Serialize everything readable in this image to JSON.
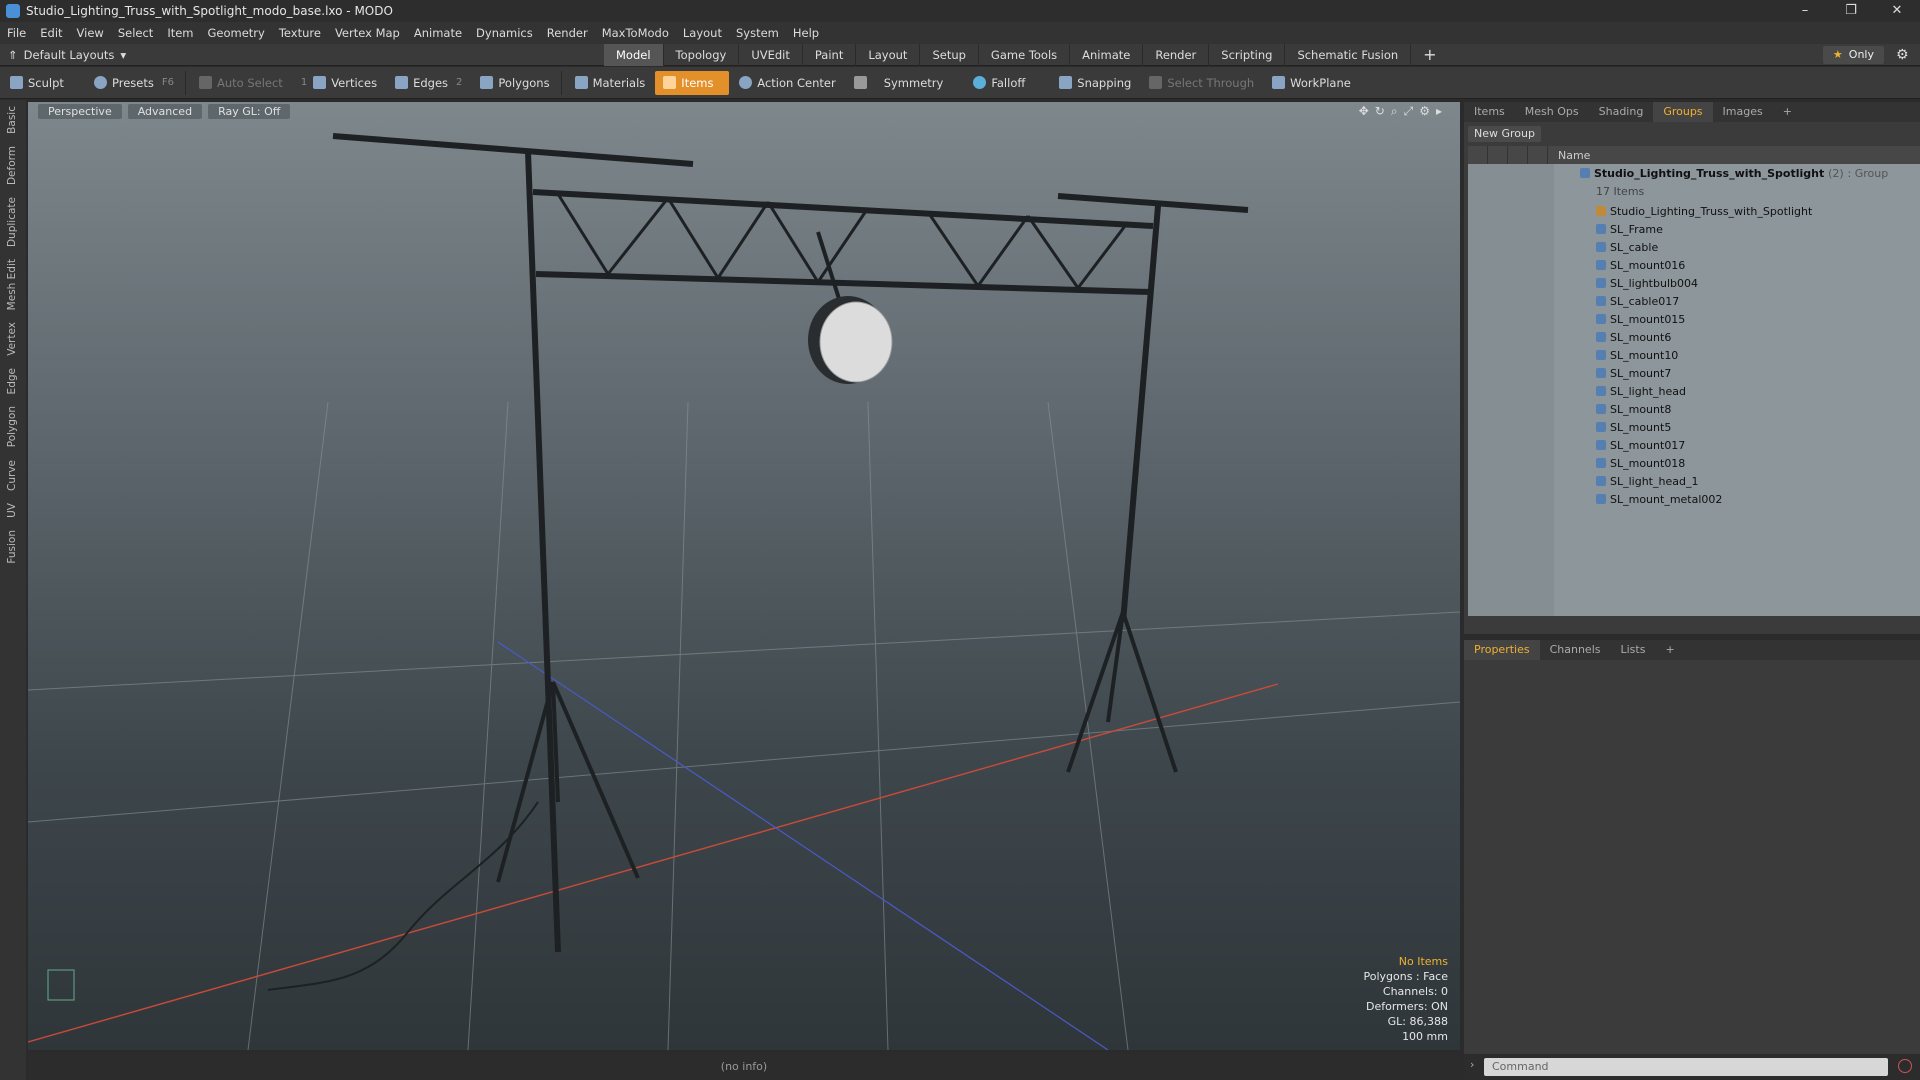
{
  "window": {
    "title": "Studio_Lighting_Truss_with_Spotlight_modo_base.lxo - MODO"
  },
  "menu": [
    "File",
    "Edit",
    "View",
    "Select",
    "Item",
    "Geometry",
    "Texture",
    "Vertex Map",
    "Animate",
    "Dynamics",
    "Render",
    "MaxToModo",
    "Layout",
    "System",
    "Help"
  ],
  "layout": {
    "selector": "Default Layouts",
    "only": "Only",
    "tabs": [
      "Model",
      "Topology",
      "UVEdit",
      "Paint",
      "Layout",
      "Setup",
      "Game Tools",
      "Animate",
      "Render",
      "Scripting",
      "Schematic Fusion"
    ]
  },
  "toolbar": {
    "sculpt": "Sculpt",
    "presets": "Presets",
    "presets_key": "F6",
    "auto_select": "Auto Select",
    "vertices": "Vertices",
    "vertices_key": "1",
    "edges": "Edges",
    "edges_key": "2",
    "polygons": "Polygons",
    "materials": "Materials",
    "items": "Items",
    "action_center": "Action Center",
    "symmetry": "Symmetry",
    "falloff": "Falloff",
    "snapping": "Snapping",
    "select_through": "Select Through",
    "workplane": "WorkPlane"
  },
  "left_tabs": [
    "Basic",
    "Deform",
    "Duplicate",
    "Mesh Edit",
    "Vertex",
    "Edge",
    "Polygon",
    "Curve",
    "UV",
    "Fusion"
  ],
  "viewport": {
    "view": "Perspective",
    "shading": "Advanced",
    "raygl": "Ray GL: Off",
    "info": {
      "items": "No Items",
      "polygons": "Polygons : Face",
      "channels": "Channels: 0",
      "deformers": "Deformers: ON",
      "gl": "GL: 86,388",
      "scale": "100 mm"
    }
  },
  "status": "(no info)",
  "items_panel": {
    "tabs": [
      "Items",
      "Mesh Ops",
      "Shading",
      "Groups",
      "Images"
    ],
    "active": "Groups",
    "new_group": "New Group",
    "col_name": "Name",
    "group": {
      "name": "Studio_Lighting_Truss_with_Spotlight",
      "count": "(2)",
      "type": ": Group",
      "sub": "17 Items"
    },
    "items": [
      "Studio_Lighting_Truss_with_Spotlight",
      "SL_Frame",
      "SL_cable",
      "SL_mount016",
      "SL_lightbulb004",
      "SL_cable017",
      "SL_mount015",
      "SL_mount6",
      "SL_mount10",
      "SL_mount7",
      "SL_light_head",
      "SL_mount8",
      "SL_mount5",
      "SL_mount017",
      "SL_mount018",
      "SL_light_head_1",
      "SL_mount_metal002"
    ]
  },
  "props_panel": {
    "tabs": [
      "Properties",
      "Channels",
      "Lists"
    ],
    "active": "Properties"
  },
  "command": {
    "placeholder": "Command"
  }
}
